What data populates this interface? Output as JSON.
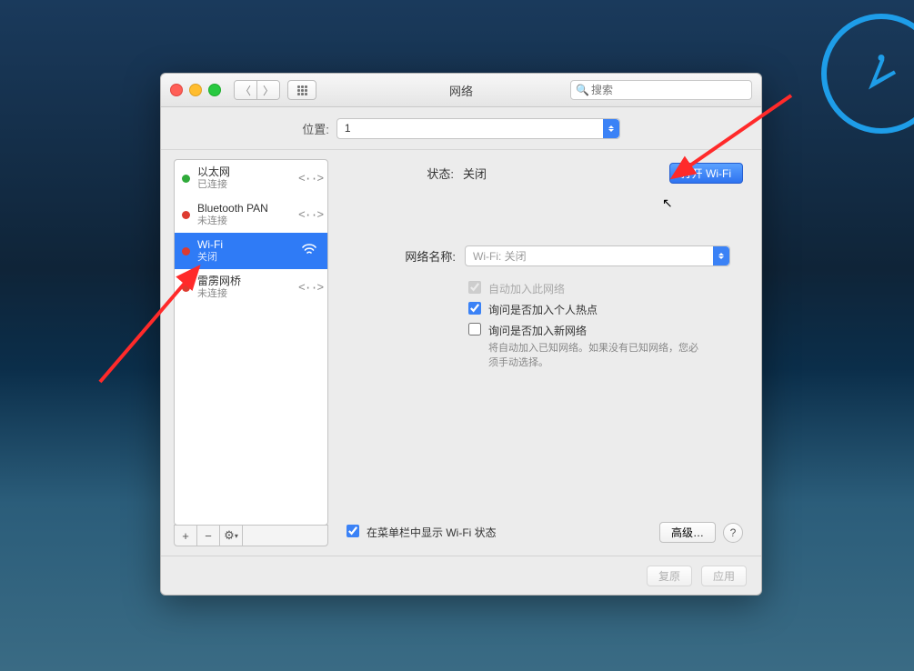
{
  "window": {
    "title": "网络",
    "search_placeholder": "搜索"
  },
  "location": {
    "label": "位置:",
    "value": "1"
  },
  "sidebar": {
    "items": [
      {
        "name": "以太网",
        "status": "已连接"
      },
      {
        "name": "Bluetooth PAN",
        "status": "未连接"
      },
      {
        "name": "Wi-Fi",
        "status": "关闭"
      },
      {
        "name": "雷雳网桥",
        "status": "未连接"
      }
    ]
  },
  "detail": {
    "status_label": "状态:",
    "status_value": "关闭",
    "toggle_button": "打开 Wi-Fi",
    "network_name_label": "网络名称:",
    "network_placeholder": "Wi-Fi: 关闭",
    "chk_auto": "自动加入此网络",
    "chk_hotspot": "询问是否加入个人热点",
    "chk_newnet": "询问是否加入新网络",
    "newnet_desc": "将自动加入已知网络。如果没有已知网络，您必须手动选择。",
    "chk_menubar": "在菜单栏中显示 Wi-Fi 状态",
    "advanced": "高级…"
  },
  "footer": {
    "revert": "复原",
    "apply": "应用"
  }
}
